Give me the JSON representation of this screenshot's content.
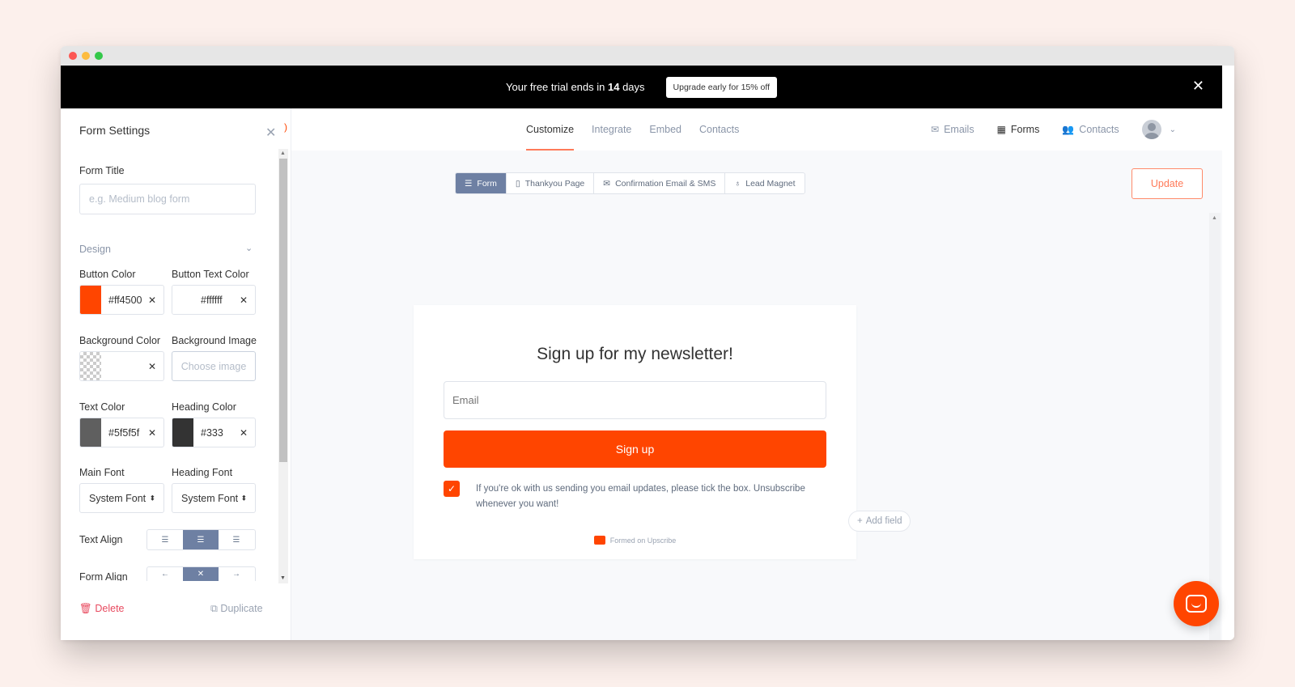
{
  "banner": {
    "text_before": "Your free trial ends in ",
    "days": "14",
    "text_after": " days",
    "upgrade_label": "Upgrade early for 15% off",
    "close_glyph": "✕"
  },
  "sidebar": {
    "title": "Form Settings",
    "close_glyph": "✕",
    "form_title_label": "Form Title",
    "form_title_placeholder": "e.g. Medium blog form",
    "design_label": "Design",
    "button_color_label": "Button Color",
    "button_color_value": "#ff4500",
    "button_text_color_label": "Button Text Color",
    "button_text_color_value": "#ffffff",
    "background_color_label": "Background Color",
    "background_image_label": "Background Image",
    "background_image_placeholder": "Choose image",
    "text_color_label": "Text Color",
    "text_color_value": "#5f5f5f",
    "heading_color_label": "Heading Color",
    "heading_color_value": "#333",
    "main_font_label": "Main Font",
    "main_font_value": "System Font",
    "heading_font_label": "Heading Font",
    "heading_font_value": "System Font",
    "text_align_label": "Text Align",
    "form_align_label": "Form Align",
    "delete_label": "Delete",
    "duplicate_label": "Duplicate",
    "clear_glyph": "✕"
  },
  "nav": {
    "tabs": [
      "Customize",
      "Integrate",
      "Embed",
      "Contacts"
    ],
    "right": {
      "emails": "Emails",
      "forms": "Forms",
      "contacts": "Contacts"
    }
  },
  "subtabs": [
    "Form",
    "Thankyou Page",
    "Confirmation Email & SMS",
    "Lead Magnet"
  ],
  "update_label": "Update",
  "form": {
    "title": "Sign up for my newsletter!",
    "email_placeholder": "Email",
    "signup_label": "Sign up",
    "consent_text": "If you're ok with us sending you email updates, please tick the box. Unsubscribe whenever you want!",
    "branding": "Formed on Upscribe"
  },
  "add_field_label": "Add field",
  "colors": {
    "accent": "#ff4500",
    "accent_soft": "#ff7a59",
    "active_seg": "#6e80a3",
    "text_swatch": "#5f5f5f",
    "heading_swatch": "#333333"
  }
}
